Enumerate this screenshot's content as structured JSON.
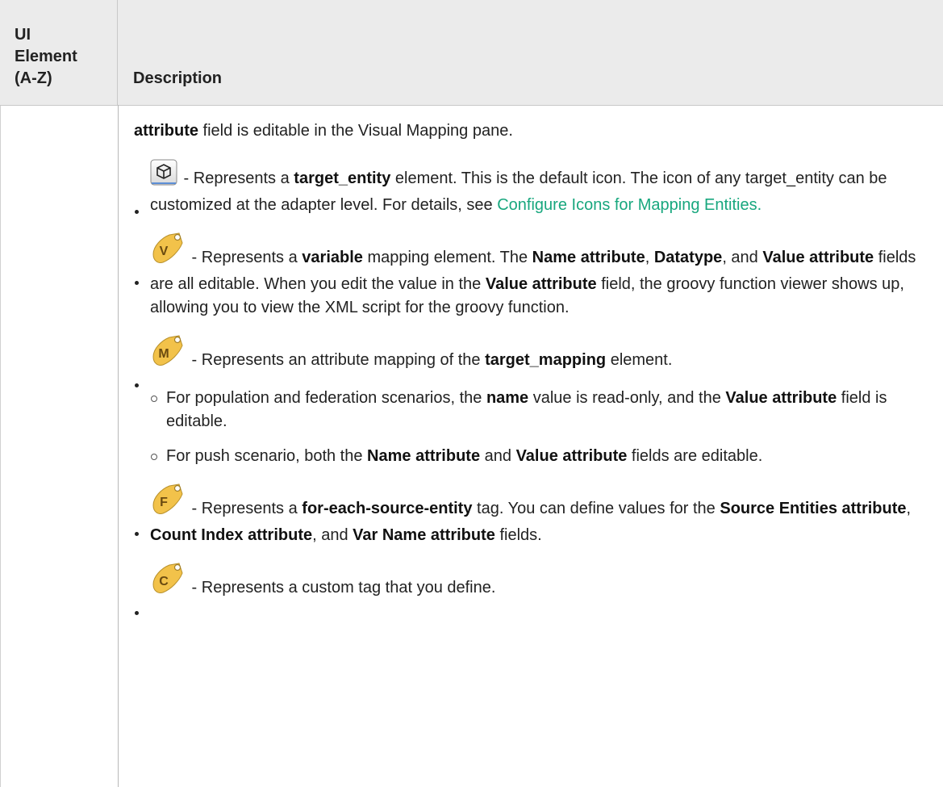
{
  "header": {
    "col1": "UI\nElement\n(A-Z)",
    "col2": "Description"
  },
  "intro": {
    "bold": "attribute",
    "rest": " field is editable in the Visual Mapping pane."
  },
  "items": [
    {
      "icon": "cube-icon",
      "t1": " - Represents a ",
      "b1": "target_entity",
      "t2": " element. This is the default icon. The icon of any target_entity can be customized at the adapter level. For details, see ",
      "link": "Configure Icons for Mapping Entities."
    },
    {
      "icon": "v-tag-icon",
      "letter": "V",
      "t1": " - Represents a ",
      "b1": "variable",
      "t2": " mapping element. The ",
      "b2": "Name attribute",
      "t3": ", ",
      "b3": "Datatype",
      "t4": ", and ",
      "b4": "Value attribute",
      "t5": " fields are all editable. When you edit the value in the ",
      "b5": "Value attribute",
      "t6": " field, the groovy function viewer shows up, allowing you to view the XML script for the groovy function."
    },
    {
      "icon": "m-tag-icon",
      "letter": "M",
      "t1": " - Represents an attribute mapping of the ",
      "b1": "target_mapping",
      "t2": " element.",
      "sub": [
        {
          "t1": "For population and federation scenarios, the ",
          "b1": "name",
          "t2": " value is read-only, and the ",
          "b2": "Value attribute",
          "t3": " field is editable."
        },
        {
          "t1": "For push scenario, both the ",
          "b1": "Name attribute",
          "t2": " and ",
          "b2": "Value attribute",
          "t3": " fields are editable."
        }
      ]
    },
    {
      "icon": "f-tag-icon",
      "letter": "F",
      "t1": " - Represents a ",
      "b1": "for-each-source-entity",
      "t2": " tag. You can define values for the ",
      "b2": "Source Entities attribute",
      "t3": ", ",
      "b3": "Count Index attribute",
      "t4": ", and ",
      "b4": "Var Name attribute",
      "t5": " fields."
    },
    {
      "icon": "c-tag-icon",
      "letter": "C",
      "t1": " - Represents a custom tag that you define."
    }
  ],
  "colors": {
    "header_bg": "#ebebeb",
    "link": "#18a77e",
    "tag_fill": "#f2c24a"
  }
}
